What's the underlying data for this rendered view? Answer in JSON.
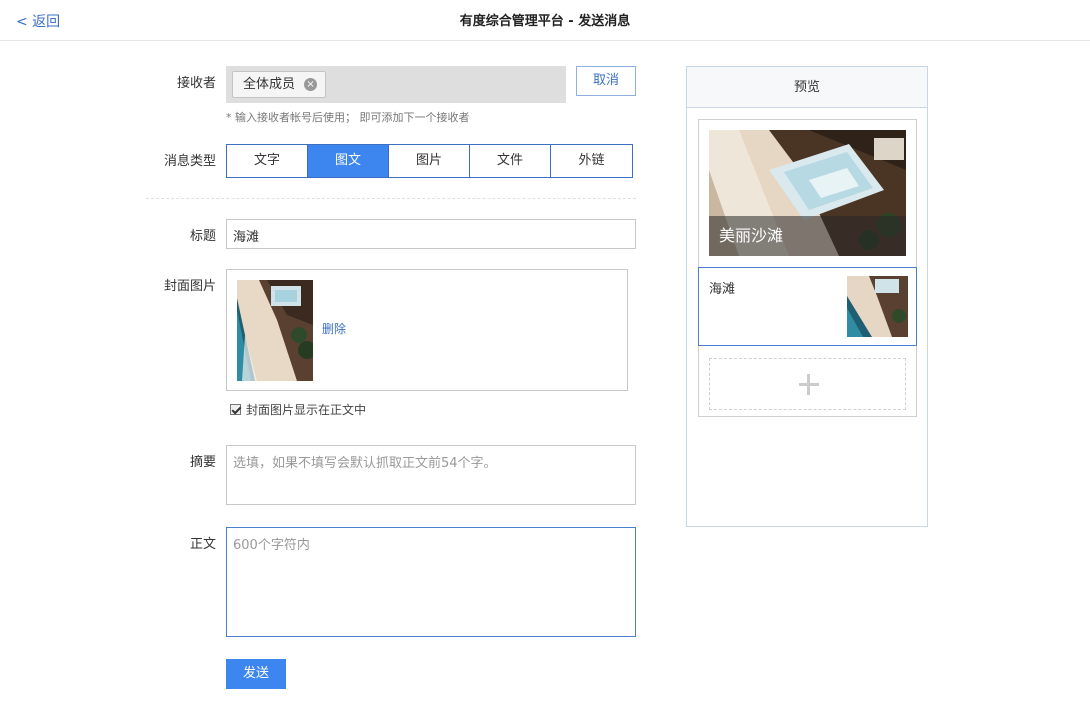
{
  "header": {
    "back_label": "< 返回",
    "title": "有度综合管理平台 - 发送消息"
  },
  "recipients": {
    "label": "接收者",
    "tags": [
      "全体成员"
    ],
    "cancel_label": "取消",
    "hint": "* 输入接收者帐号后使用； 即可添加下一个接收者"
  },
  "message_type": {
    "label": "消息类型",
    "tabs": [
      "文字",
      "图文",
      "图片",
      "文件",
      "外链"
    ],
    "selected": "图文"
  },
  "title_field": {
    "label": "标题",
    "value": "海滩"
  },
  "cover": {
    "label": "封面图片",
    "delete_label": "删除",
    "show_in_body_label": "封面图片显示在正文中",
    "show_in_body_checked": true
  },
  "summary": {
    "label": "摘要",
    "placeholder": "选填，如果不填写会默认抓取正文前54个字。"
  },
  "body": {
    "label": "正文",
    "placeholder": "600个字符内"
  },
  "send_label": "发送",
  "preview": {
    "header": "预览",
    "main_title": "美丽沙滩",
    "item_title": "海滩"
  },
  "colors": {
    "accent": "#3d86f0",
    "link": "#3a6fc4"
  }
}
